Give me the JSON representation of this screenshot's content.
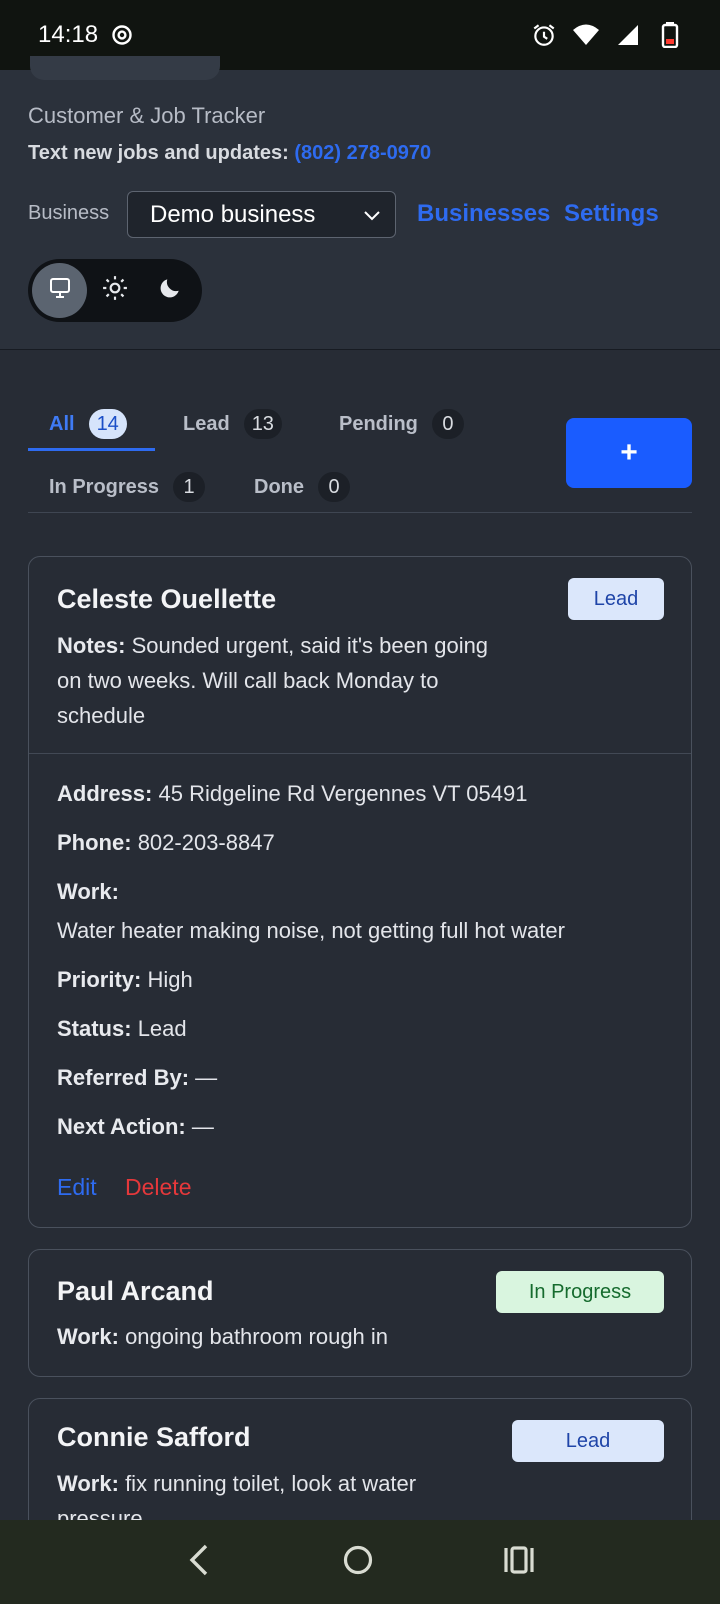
{
  "status_bar": {
    "time": "14:18",
    "icons": [
      "settings-icon",
      "alarm-icon",
      "wifi-icon",
      "signal-icon",
      "battery-icon"
    ]
  },
  "header": {
    "subtitle": "Customer & Job Tracker",
    "text_line_prefix": "Text new jobs and updates:",
    "text_line_phone": "(802) 278-0970",
    "business_label": "Business",
    "business_selected": "Demo business",
    "businesses_link": "Businesses",
    "settings_link": "Settings",
    "theme_options": [
      "system",
      "light",
      "dark"
    ],
    "theme_selected": "system"
  },
  "tabs": [
    {
      "label": "All",
      "count": "14",
      "active": true
    },
    {
      "label": "Lead",
      "count": "13"
    },
    {
      "label": "Pending",
      "count": "0"
    },
    {
      "label": "In Progress",
      "count": "1"
    },
    {
      "label": "Done",
      "count": "0"
    }
  ],
  "add_button_label": "+",
  "cards": [
    {
      "name": "Celeste Ouellette",
      "badge": "Lead",
      "notes_label": "Notes:",
      "notes_lines": [
        "Sounded urgent, said it's been going",
        "on two weeks. Will call back Monday to",
        "schedule"
      ],
      "fields": [
        {
          "label": "Address:",
          "value": "45 Ridgeline Rd Vergennes VT 05491"
        },
        {
          "label": "Phone:",
          "value": "802-203-8847"
        },
        {
          "label": "Work:",
          "value": ""
        },
        {
          "label": "",
          "value": "Water heater making noise, not getting full hot water"
        },
        {
          "label": "Priority:",
          "value": "High"
        },
        {
          "label": "Status:",
          "value": "Lead"
        },
        {
          "label": "Referred By:",
          "value": "—"
        },
        {
          "label": "Next Action:",
          "value": "—"
        }
      ],
      "edit_label": "Edit",
      "delete_label": "Delete"
    },
    {
      "name": "Paul Arcand",
      "badge": "In Progress",
      "work_label": "Work:",
      "work_value": "ongoing bathroom rough in"
    },
    {
      "name": "Connie Safford",
      "badge": "Lead",
      "work_label": "Work:",
      "work_value": "fix running toilet, look at water",
      "work_value_cut": "pressure"
    }
  ],
  "colors": {
    "accent": "#2e6bf0",
    "add_button": "#1a5cff",
    "delete": "#e5383b",
    "background": "#272c35"
  }
}
